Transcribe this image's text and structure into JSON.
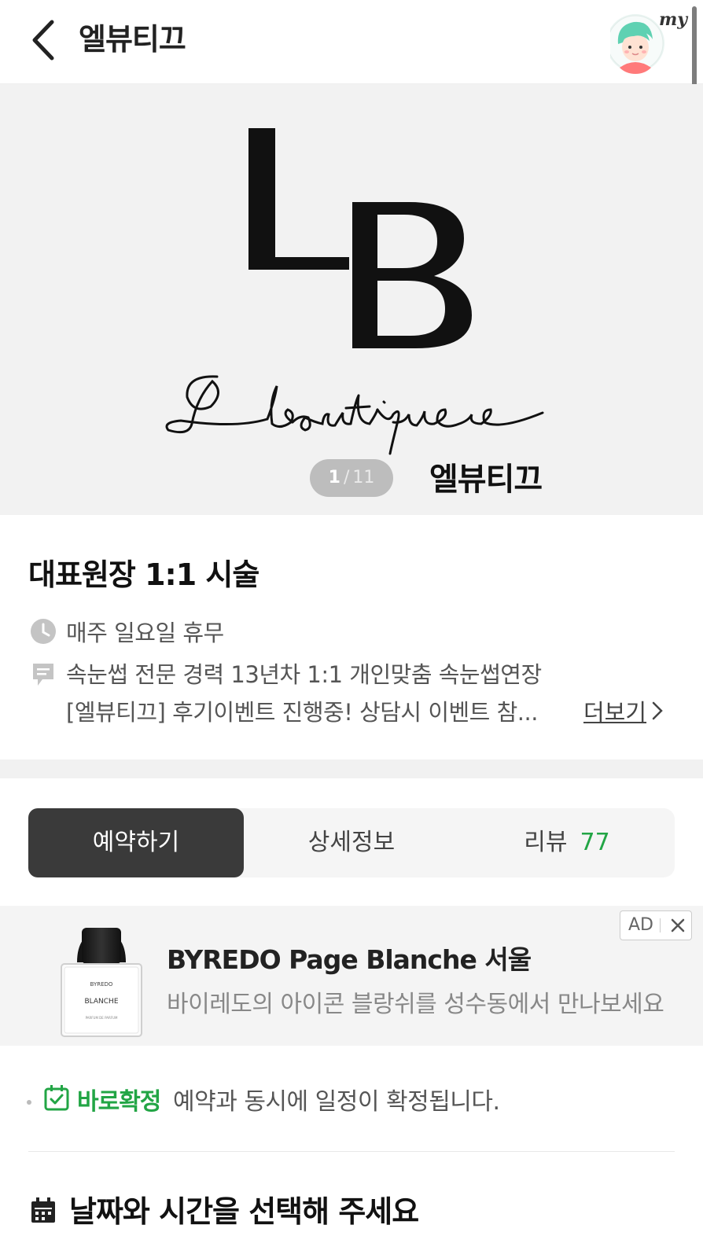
{
  "header": {
    "title": "엘뷰티끄",
    "my_label": "my",
    "back_icon": "chevron-left-icon"
  },
  "hero": {
    "logo_letters": "LB",
    "logo_script": "Lboutique",
    "brand_kr": "엘뷰티끄",
    "counter_current": "1",
    "counter_separator": "/",
    "counter_total": "11"
  },
  "info": {
    "name": "대표원장 1:1 시술",
    "hours": "매주 일요일 휴무",
    "desc_line1": "속눈썹 전문 경력 13년차 1:1 개인맞춤 속눈썹연장",
    "desc_line2": "[엘뷰티끄] 후기이벤트 진행중! 상담시 이벤트 참...",
    "more_label": "더보기"
  },
  "tabs": {
    "reserve": "예약하기",
    "detail": "상세정보",
    "review": "리뷰",
    "review_count": "77"
  },
  "ad": {
    "title": "BYREDO Page Blanche 서울",
    "desc": "바이레도의 아이콘 블랑쉬를 성수동에서 만나보세요",
    "badge": "AD",
    "close": "✕",
    "bottle_brand": "BYREDO",
    "bottle_name": "BLANCHE",
    "bottle_sub": "PARFUM DE PARFUM"
  },
  "confirm": {
    "label": "바로확정",
    "text": "예약과 동시에 일정이 확정됩니다."
  },
  "date_section": {
    "heading": "날짜와 시간을 선택해 주세요"
  },
  "colors": {
    "accent_green": "#22a545",
    "tab_active_bg": "#3a3a3a"
  }
}
